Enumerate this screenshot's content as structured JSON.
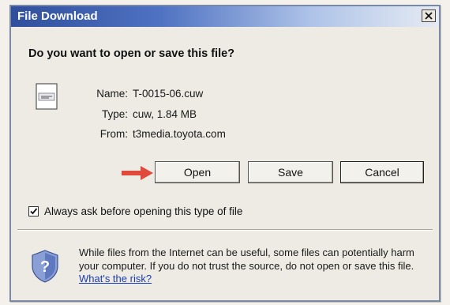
{
  "window": {
    "title": "File Download"
  },
  "dialog": {
    "question": "Do you want to open or save this file?",
    "file": {
      "name_label": "Name:",
      "name_value": "T-0015-06.cuw",
      "type_label": "Type:",
      "type_value": "cuw, 1.84 MB",
      "from_label": "From:",
      "from_value": "t3media.toyota.com"
    },
    "buttons": {
      "open": "Open",
      "save": "Save",
      "cancel": "Cancel"
    },
    "checkbox": {
      "label": "Always ask before opening this type of file",
      "checked": true
    },
    "warning": {
      "text": "While files from the Internet can be useful, some files can potentially harm your computer. If you do not trust the source, do not open or save this file. ",
      "link": "What's the risk?"
    }
  },
  "icons": {
    "close": "close-icon",
    "file": "file-icon",
    "arrow": "arrow-right-icon",
    "shield": "shield-question-icon",
    "check": "checkmark-icon"
  },
  "colors": {
    "titlebar_start": "#2f4f9c",
    "titlebar_end": "#e6ebf3",
    "arrow": "#e04a3c",
    "link": "#1a3cb0"
  }
}
